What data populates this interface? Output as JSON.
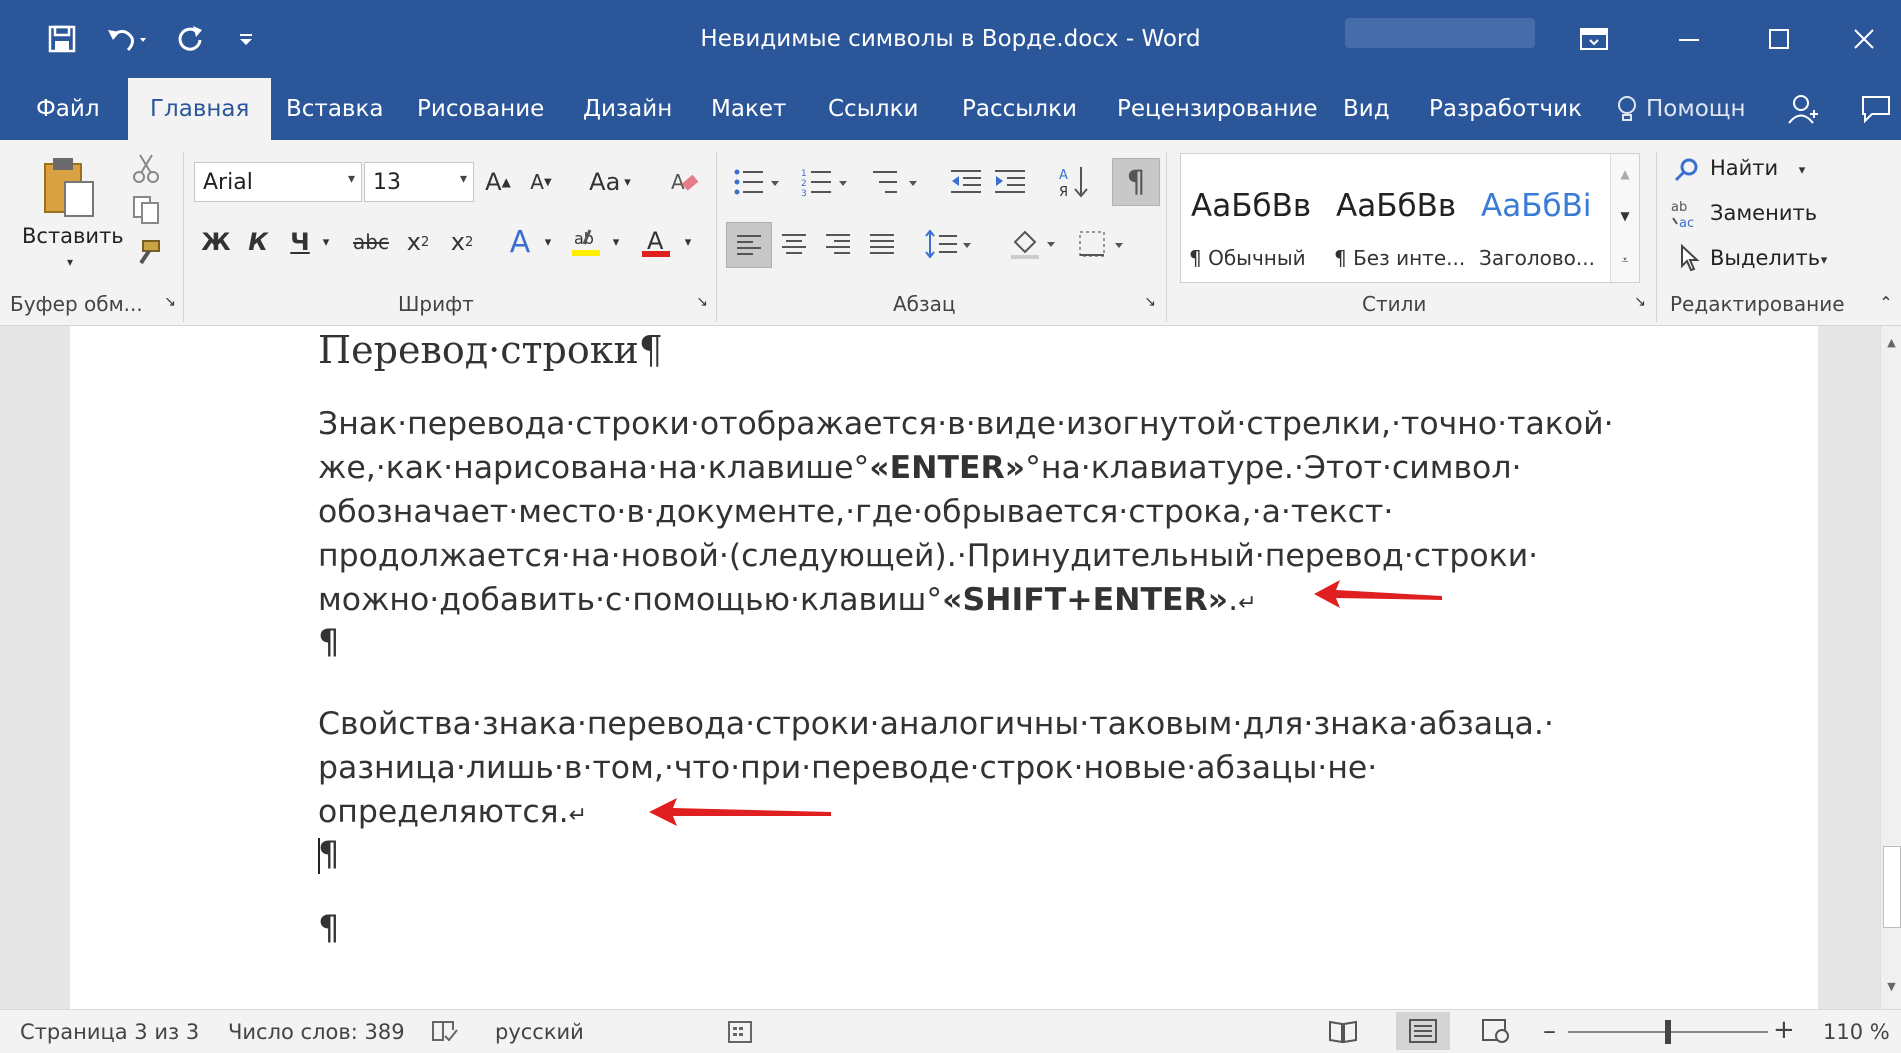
{
  "app": {
    "title": "Невидимые символы в Ворде.docx  -  Word"
  },
  "qat": {
    "save_icon": "save-icon",
    "undo_icon": "undo-icon",
    "redo_icon": "redo-icon",
    "customize_icon": "customize-icon"
  },
  "tabs": [
    "Файл",
    "Главная",
    "Вставка",
    "Рисование",
    "Дизайн",
    "Макет",
    "Ссылки",
    "Рассылки",
    "Рецензирование",
    "Вид",
    "Разработчик"
  ],
  "help_label": "Помощн",
  "ribbon": {
    "clipboard": {
      "paste_label": "Вставить",
      "group_label": "Буфер обм..."
    },
    "font": {
      "name": "Arial",
      "size": "13",
      "case_label": "Aa",
      "bold": "Ж",
      "italic": "К",
      "underline": "Ч",
      "strike": "abc",
      "group_label": "Шрифт"
    },
    "paragraph": {
      "group_label": "Абзац"
    },
    "styles": {
      "items": [
        {
          "sample": "АаБбВв",
          "name": "¶ Обычный"
        },
        {
          "sample": "АаБбВв",
          "name": "¶ Без инте..."
        },
        {
          "sample": "АаБбВі",
          "name": "Заголово..."
        }
      ],
      "group_label": "Стили"
    },
    "editing": {
      "find": "Найти",
      "replace": "Заменить",
      "select": "Выделить",
      "group_label": "Редактирование"
    }
  },
  "document": {
    "heading": "Перевод·строки¶",
    "para1": [
      "Знак·перевода·строки·отображается·в·виде·изогнутой·стрелки,·точно·такой·",
      "же,·как·нарисована·на·клавише°«ENTER»°на·клавиатуре.·Этот·символ·",
      "обозначает·место·в·документе,·где·обрывается·строка,·а·текст·",
      "продолжается·на·новой·(следующей).·Принудительный·перевод·строки·",
      "можно·добавить·с·помощью·клавиш°«SHIFT+ENTER».↵"
    ],
    "para2": [
      "Свойства·знака·перевода·строки·аналогичны·таковым·для·знака·абзаца.·",
      "разница·лишь·в·том,·что·при·переводе·строк·новые·абзацы·не·",
      "определяются.↵"
    ],
    "pilcrow": "¶",
    "bold_enter": "«ENTER»",
    "bold_shift": "«SHIFT+ENTER»"
  },
  "status": {
    "page": "Страница 3 из 3",
    "words": "Число слов: 389",
    "lang": "русский",
    "zoom": "110 %"
  },
  "colors": {
    "accent": "#2b579a",
    "arrow": "#e02020"
  }
}
